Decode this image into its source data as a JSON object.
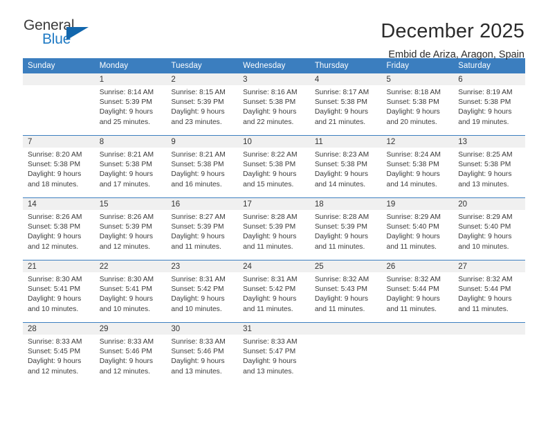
{
  "brand": {
    "name_part1": "General",
    "name_part2": "Blue",
    "flag_icon": "blue-flag-icon",
    "accent_color": "#1f7ac4",
    "flag_color": "#1166ad"
  },
  "header": {
    "title": "December 2025",
    "subtitle": "Embid de Ariza, Aragon, Spain"
  },
  "calendar": {
    "header_bg": "#3b7ebf",
    "daynum_bg": "#f0f0f0",
    "weekday_headers": [
      "Sunday",
      "Monday",
      "Tuesday",
      "Wednesday",
      "Thursday",
      "Friday",
      "Saturday"
    ],
    "weeks": [
      [
        {
          "day": "",
          "sunrise": "",
          "sunset": "",
          "daylight_line1": "",
          "daylight_line2": "",
          "empty": true
        },
        {
          "day": "1",
          "sunrise": "Sunrise: 8:14 AM",
          "sunset": "Sunset: 5:39 PM",
          "daylight_line1": "Daylight: 9 hours",
          "daylight_line2": "and 25 minutes."
        },
        {
          "day": "2",
          "sunrise": "Sunrise: 8:15 AM",
          "sunset": "Sunset: 5:39 PM",
          "daylight_line1": "Daylight: 9 hours",
          "daylight_line2": "and 23 minutes."
        },
        {
          "day": "3",
          "sunrise": "Sunrise: 8:16 AM",
          "sunset": "Sunset: 5:38 PM",
          "daylight_line1": "Daylight: 9 hours",
          "daylight_line2": "and 22 minutes."
        },
        {
          "day": "4",
          "sunrise": "Sunrise: 8:17 AM",
          "sunset": "Sunset: 5:38 PM",
          "daylight_line1": "Daylight: 9 hours",
          "daylight_line2": "and 21 minutes."
        },
        {
          "day": "5",
          "sunrise": "Sunrise: 8:18 AM",
          "sunset": "Sunset: 5:38 PM",
          "daylight_line1": "Daylight: 9 hours",
          "daylight_line2": "and 20 minutes."
        },
        {
          "day": "6",
          "sunrise": "Sunrise: 8:19 AM",
          "sunset": "Sunset: 5:38 PM",
          "daylight_line1": "Daylight: 9 hours",
          "daylight_line2": "and 19 minutes."
        }
      ],
      [
        {
          "day": "7",
          "sunrise": "Sunrise: 8:20 AM",
          "sunset": "Sunset: 5:38 PM",
          "daylight_line1": "Daylight: 9 hours",
          "daylight_line2": "and 18 minutes."
        },
        {
          "day": "8",
          "sunrise": "Sunrise: 8:21 AM",
          "sunset": "Sunset: 5:38 PM",
          "daylight_line1": "Daylight: 9 hours",
          "daylight_line2": "and 17 minutes."
        },
        {
          "day": "9",
          "sunrise": "Sunrise: 8:21 AM",
          "sunset": "Sunset: 5:38 PM",
          "daylight_line1": "Daylight: 9 hours",
          "daylight_line2": "and 16 minutes."
        },
        {
          "day": "10",
          "sunrise": "Sunrise: 8:22 AM",
          "sunset": "Sunset: 5:38 PM",
          "daylight_line1": "Daylight: 9 hours",
          "daylight_line2": "and 15 minutes."
        },
        {
          "day": "11",
          "sunrise": "Sunrise: 8:23 AM",
          "sunset": "Sunset: 5:38 PM",
          "daylight_line1": "Daylight: 9 hours",
          "daylight_line2": "and 14 minutes."
        },
        {
          "day": "12",
          "sunrise": "Sunrise: 8:24 AM",
          "sunset": "Sunset: 5:38 PM",
          "daylight_line1": "Daylight: 9 hours",
          "daylight_line2": "and 14 minutes."
        },
        {
          "day": "13",
          "sunrise": "Sunrise: 8:25 AM",
          "sunset": "Sunset: 5:38 PM",
          "daylight_line1": "Daylight: 9 hours",
          "daylight_line2": "and 13 minutes."
        }
      ],
      [
        {
          "day": "14",
          "sunrise": "Sunrise: 8:26 AM",
          "sunset": "Sunset: 5:38 PM",
          "daylight_line1": "Daylight: 9 hours",
          "daylight_line2": "and 12 minutes."
        },
        {
          "day": "15",
          "sunrise": "Sunrise: 8:26 AM",
          "sunset": "Sunset: 5:39 PM",
          "daylight_line1": "Daylight: 9 hours",
          "daylight_line2": "and 12 minutes."
        },
        {
          "day": "16",
          "sunrise": "Sunrise: 8:27 AM",
          "sunset": "Sunset: 5:39 PM",
          "daylight_line1": "Daylight: 9 hours",
          "daylight_line2": "and 11 minutes."
        },
        {
          "day": "17",
          "sunrise": "Sunrise: 8:28 AM",
          "sunset": "Sunset: 5:39 PM",
          "daylight_line1": "Daylight: 9 hours",
          "daylight_line2": "and 11 minutes."
        },
        {
          "day": "18",
          "sunrise": "Sunrise: 8:28 AM",
          "sunset": "Sunset: 5:39 PM",
          "daylight_line1": "Daylight: 9 hours",
          "daylight_line2": "and 11 minutes."
        },
        {
          "day": "19",
          "sunrise": "Sunrise: 8:29 AM",
          "sunset": "Sunset: 5:40 PM",
          "daylight_line1": "Daylight: 9 hours",
          "daylight_line2": "and 11 minutes."
        },
        {
          "day": "20",
          "sunrise": "Sunrise: 8:29 AM",
          "sunset": "Sunset: 5:40 PM",
          "daylight_line1": "Daylight: 9 hours",
          "daylight_line2": "and 10 minutes."
        }
      ],
      [
        {
          "day": "21",
          "sunrise": "Sunrise: 8:30 AM",
          "sunset": "Sunset: 5:41 PM",
          "daylight_line1": "Daylight: 9 hours",
          "daylight_line2": "and 10 minutes."
        },
        {
          "day": "22",
          "sunrise": "Sunrise: 8:30 AM",
          "sunset": "Sunset: 5:41 PM",
          "daylight_line1": "Daylight: 9 hours",
          "daylight_line2": "and 10 minutes."
        },
        {
          "day": "23",
          "sunrise": "Sunrise: 8:31 AM",
          "sunset": "Sunset: 5:42 PM",
          "daylight_line1": "Daylight: 9 hours",
          "daylight_line2": "and 10 minutes."
        },
        {
          "day": "24",
          "sunrise": "Sunrise: 8:31 AM",
          "sunset": "Sunset: 5:42 PM",
          "daylight_line1": "Daylight: 9 hours",
          "daylight_line2": "and 11 minutes."
        },
        {
          "day": "25",
          "sunrise": "Sunrise: 8:32 AM",
          "sunset": "Sunset: 5:43 PM",
          "daylight_line1": "Daylight: 9 hours",
          "daylight_line2": "and 11 minutes."
        },
        {
          "day": "26",
          "sunrise": "Sunrise: 8:32 AM",
          "sunset": "Sunset: 5:44 PM",
          "daylight_line1": "Daylight: 9 hours",
          "daylight_line2": "and 11 minutes."
        },
        {
          "day": "27",
          "sunrise": "Sunrise: 8:32 AM",
          "sunset": "Sunset: 5:44 PM",
          "daylight_line1": "Daylight: 9 hours",
          "daylight_line2": "and 11 minutes."
        }
      ],
      [
        {
          "day": "28",
          "sunrise": "Sunrise: 8:33 AM",
          "sunset": "Sunset: 5:45 PM",
          "daylight_line1": "Daylight: 9 hours",
          "daylight_line2": "and 12 minutes."
        },
        {
          "day": "29",
          "sunrise": "Sunrise: 8:33 AM",
          "sunset": "Sunset: 5:46 PM",
          "daylight_line1": "Daylight: 9 hours",
          "daylight_line2": "and 12 minutes."
        },
        {
          "day": "30",
          "sunrise": "Sunrise: 8:33 AM",
          "sunset": "Sunset: 5:46 PM",
          "daylight_line1": "Daylight: 9 hours",
          "daylight_line2": "and 13 minutes."
        },
        {
          "day": "31",
          "sunrise": "Sunrise: 8:33 AM",
          "sunset": "Sunset: 5:47 PM",
          "daylight_line1": "Daylight: 9 hours",
          "daylight_line2": "and 13 minutes."
        },
        {
          "day": "",
          "sunrise": "",
          "sunset": "",
          "daylight_line1": "",
          "daylight_line2": "",
          "empty": true
        },
        {
          "day": "",
          "sunrise": "",
          "sunset": "",
          "daylight_line1": "",
          "daylight_line2": "",
          "empty": true
        },
        {
          "day": "",
          "sunrise": "",
          "sunset": "",
          "daylight_line1": "",
          "daylight_line2": "",
          "empty": true
        }
      ]
    ]
  }
}
